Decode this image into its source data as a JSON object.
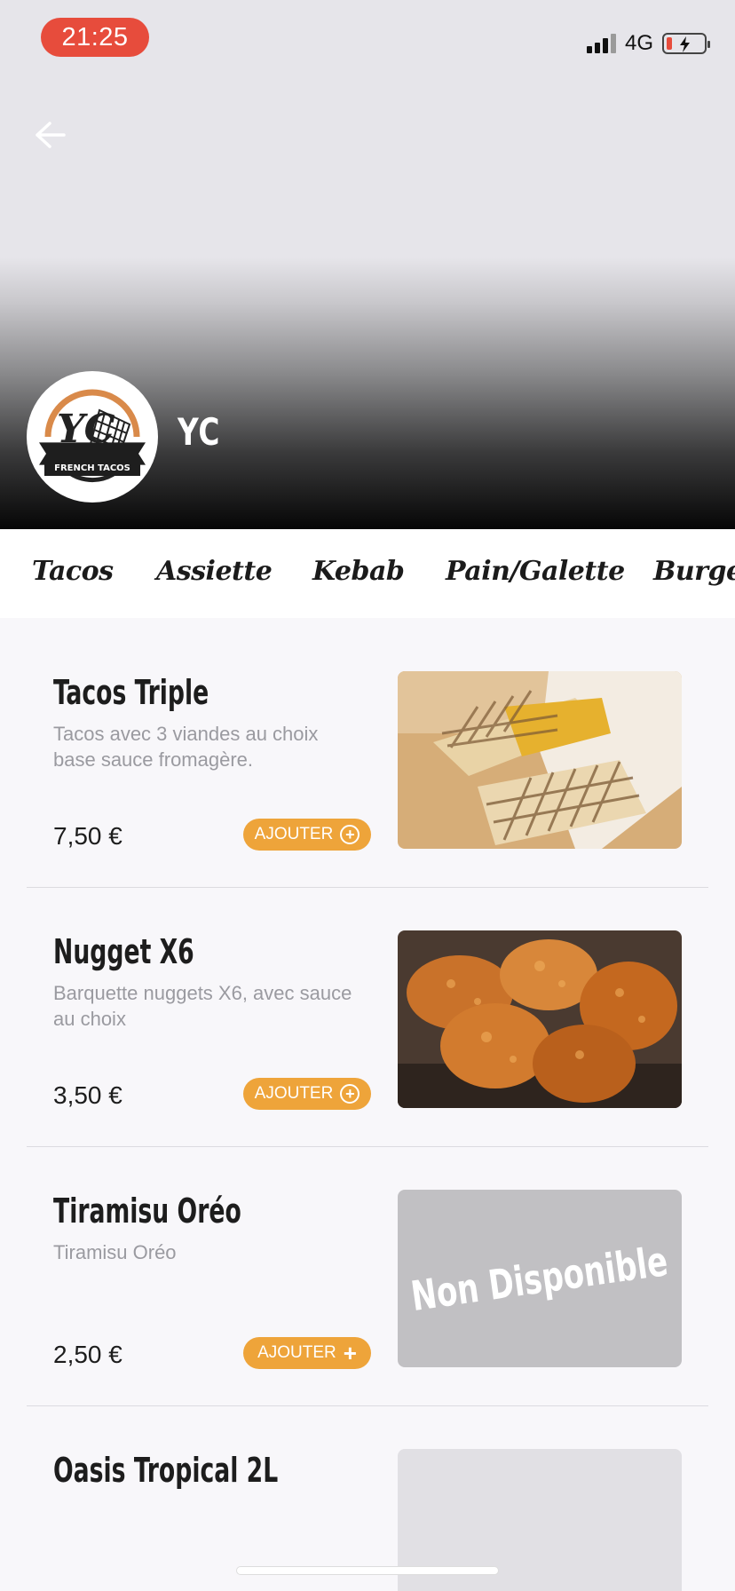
{
  "status_bar": {
    "time": "21:25",
    "network": "4G"
  },
  "restaurant": {
    "name": "YC",
    "logo_initials": "YC",
    "logo_subtitle": "FRENCH TACOS"
  },
  "categories": [
    "Tacos",
    "Assiette",
    "Kebab",
    "Pain/Galette",
    "Burger"
  ],
  "add_label": "AJOUTER",
  "products": [
    {
      "name": "Tacos Triple",
      "description": "Tacos avec 3 viandes au choix base sauce fromagère.",
      "price": "7,50 €",
      "image": "tacos-photo"
    },
    {
      "name": "Nugget X6",
      "description": "Barquette nuggets X6, avec sauce au choix",
      "price": "3,50 €",
      "image": "nuggets-photo"
    },
    {
      "name": "Tiramisu  Oréo",
      "description": "Tiramisu  Oréo",
      "price": "2,50 €",
      "image_status": "Non Disponible"
    },
    {
      "name": "Oasis Tropical 2L",
      "description": "",
      "price": "",
      "image": "placeholder"
    }
  ],
  "colors": {
    "accent": "#eea43a",
    "status_time_bg": "#e74c3c",
    "unavailable_bg": "#c1c0c3"
  }
}
